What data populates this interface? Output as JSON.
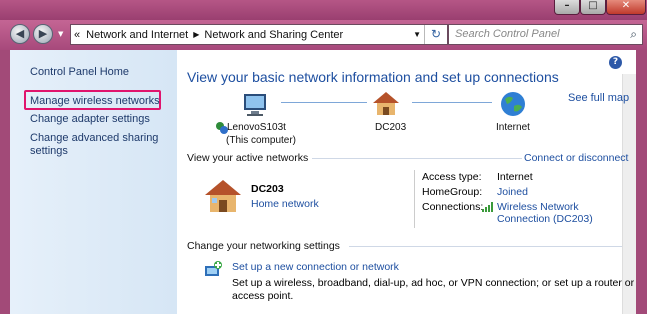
{
  "window": {
    "min_label": "–",
    "max_label": "□",
    "close_label": "✕"
  },
  "address": {
    "back_glyph": "◀",
    "forward_glyph": "▶",
    "dropdown_glyph": "▼",
    "prefix_glyph": "«",
    "path": [
      "Network and Internet",
      "Network and Sharing Center"
    ],
    "refresh_glyph": "↻",
    "search_placeholder": "Search Control Panel",
    "search_icon_glyph": "⌕"
  },
  "sidebar": {
    "items": [
      {
        "label": "Control Panel Home"
      },
      {
        "label": "Manage wireless networks"
      },
      {
        "label": "Change adapter settings"
      },
      {
        "label": "Change advanced sharing"
      },
      {
        "label": "settings"
      }
    ]
  },
  "main": {
    "help_glyph": "?",
    "heading": "View your basic network information and set up connections",
    "see_full_map": "See full map",
    "nodes": [
      {
        "name": "LenovoS103t",
        "sub": "(This computer)"
      },
      {
        "name": "DC203"
      },
      {
        "name": "Internet"
      }
    ],
    "active": {
      "title": "View your active networks",
      "connect_link": "Connect or disconnect",
      "network_name": "DC203",
      "network_type": "Home network",
      "access_label": "Access type:",
      "access_value": "Internet",
      "homegroup_label": "HomeGroup:",
      "homegroup_value": "Joined",
      "connections_label": "Connections:",
      "connection_line1": "Wireless Network",
      "connection_line2": "Connection (DC203)"
    },
    "settings": {
      "title": "Change your networking settings",
      "setup_link": "Set up a new connection or network",
      "setup_desc_line1": "Set up a wireless, broadband, dial-up, ad hoc, or VPN connection; or set up a router or",
      "setup_desc_line2": "access point."
    }
  },
  "colors": {
    "link": "#1e4fa0",
    "highlight": "#e0146d",
    "chrome": "#a24a78"
  }
}
